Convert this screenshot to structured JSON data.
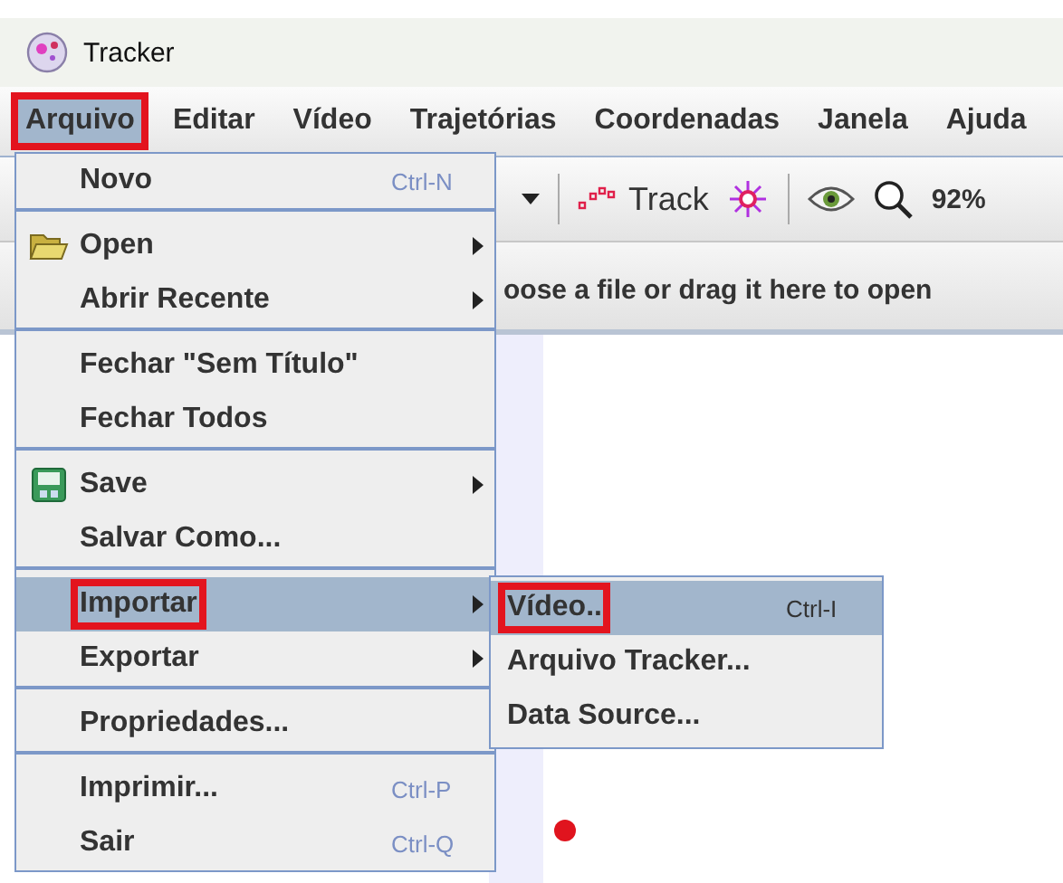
{
  "window": {
    "title": "Tracker"
  },
  "menubar": [
    {
      "label": "Arquivo",
      "selected": true,
      "marked": true
    },
    {
      "label": "Editar",
      "selected": false,
      "marked": false
    },
    {
      "label": "Vídeo",
      "selected": false,
      "marked": false
    },
    {
      "label": "Trajetórias",
      "selected": false,
      "marked": false
    },
    {
      "label": "Coordenadas",
      "selected": false,
      "marked": false
    },
    {
      "label": "Janela",
      "selected": false,
      "marked": false
    },
    {
      "label": "Ajuda",
      "selected": false,
      "marked": false
    }
  ],
  "toolbar": {
    "track_button": "Track",
    "zoom": "92%"
  },
  "notice": "oose a file or drag it here to open",
  "file_menu": [
    {
      "kind": "item",
      "label": "Novo",
      "shortcut": "Ctrl-N",
      "submenu": false,
      "selected": false,
      "marked": false
    },
    {
      "kind": "separator"
    },
    {
      "kind": "item",
      "label": "Open",
      "submenu": true,
      "selected": false,
      "marked": false
    },
    {
      "kind": "item",
      "label": "Abrir Recente",
      "submenu": true,
      "selected": false,
      "marked": false
    },
    {
      "kind": "separator"
    },
    {
      "kind": "item",
      "label": "Fechar \"Sem Título\"",
      "submenu": false,
      "selected": false,
      "marked": false
    },
    {
      "kind": "item",
      "label": "Fechar Todos",
      "submenu": false,
      "selected": false,
      "marked": false
    },
    {
      "kind": "separator"
    },
    {
      "kind": "item",
      "label": "Save",
      "submenu": true,
      "selected": false,
      "marked": false
    },
    {
      "kind": "item",
      "label": "Salvar Como...",
      "submenu": false,
      "selected": false,
      "marked": false
    },
    {
      "kind": "separator"
    },
    {
      "kind": "item",
      "label": "Importar",
      "submenu": true,
      "selected": true,
      "marked": true
    },
    {
      "kind": "item",
      "label": "Exportar",
      "submenu": true,
      "selected": false,
      "marked": false
    },
    {
      "kind": "separator"
    },
    {
      "kind": "item",
      "label": "Propriedades...",
      "submenu": false,
      "selected": false,
      "marked": false
    },
    {
      "kind": "separator"
    },
    {
      "kind": "item",
      "label": "Imprimir...",
      "shortcut": "Ctrl-P",
      "submenu": false,
      "selected": false,
      "marked": false
    },
    {
      "kind": "item",
      "label": "Sair",
      "shortcut": "Ctrl-Q",
      "submenu": false,
      "selected": false,
      "marked": false
    }
  ],
  "import_menu": [
    {
      "label": "Vídeo..",
      "shortcut": "Ctrl-I",
      "selected": true,
      "marked": true
    },
    {
      "label": "Arquivo Tracker...",
      "selected": false,
      "marked": false
    },
    {
      "label": "Data Source...",
      "selected": false,
      "marked": false
    }
  ]
}
